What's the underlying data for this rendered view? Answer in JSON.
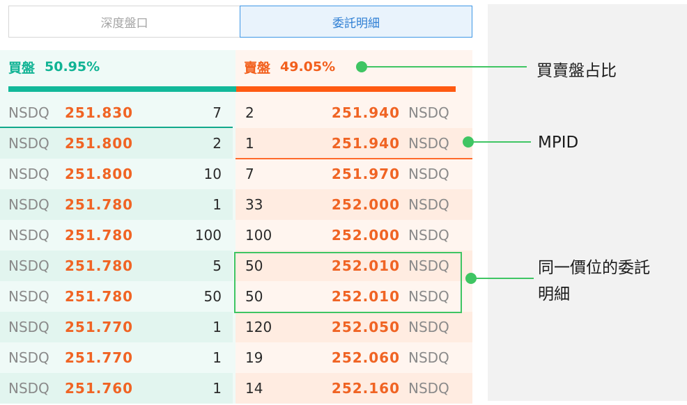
{
  "tabs": [
    {
      "label": "深度盤口"
    },
    {
      "label": "委託明細"
    }
  ],
  "summary": {
    "bid_label": "買盤",
    "bid_ratio": "50.95%",
    "ask_label": "賣盤",
    "ask_ratio": "49.05%"
  },
  "bid_rows": [
    {
      "mpid": "NSDQ",
      "price": "251.830",
      "qty": "7"
    },
    {
      "mpid": "NSDQ",
      "price": "251.800",
      "qty": "2"
    },
    {
      "mpid": "NSDQ",
      "price": "251.800",
      "qty": "10"
    },
    {
      "mpid": "NSDQ",
      "price": "251.780",
      "qty": "1"
    },
    {
      "mpid": "NSDQ",
      "price": "251.780",
      "qty": "100"
    },
    {
      "mpid": "NSDQ",
      "price": "251.780",
      "qty": "5"
    },
    {
      "mpid": "NSDQ",
      "price": "251.780",
      "qty": "50"
    },
    {
      "mpid": "NSDQ",
      "price": "251.770",
      "qty": "1"
    },
    {
      "mpid": "NSDQ",
      "price": "251.770",
      "qty": "1"
    },
    {
      "mpid": "NSDQ",
      "price": "251.760",
      "qty": "1"
    }
  ],
  "ask_rows": [
    {
      "qty": "2",
      "price": "251.940",
      "mpid": "NSDQ"
    },
    {
      "qty": "1",
      "price": "251.940",
      "mpid": "NSDQ"
    },
    {
      "qty": "7",
      "price": "251.970",
      "mpid": "NSDQ"
    },
    {
      "qty": "33",
      "price": "252.000",
      "mpid": "NSDQ"
    },
    {
      "qty": "100",
      "price": "252.000",
      "mpid": "NSDQ"
    },
    {
      "qty": "50",
      "price": "252.010",
      "mpid": "NSDQ"
    },
    {
      "qty": "50",
      "price": "252.010",
      "mpid": "NSDQ"
    },
    {
      "qty": "120",
      "price": "252.050",
      "mpid": "NSDQ"
    },
    {
      "qty": "19",
      "price": "252.060",
      "mpid": "NSDQ"
    },
    {
      "qty": "14",
      "price": "252.160",
      "mpid": "NSDQ"
    }
  ],
  "annotations": {
    "ratio": "買賣盤占比",
    "mpid": "MPID",
    "same_price_line1": "同一價位的委託",
    "same_price_line2": "明細"
  },
  "colors": {
    "bid": "#12b89a",
    "ask": "#ff5a12",
    "price": "#f06424",
    "annotation": "#3fc563",
    "tab_active": "#3e97e6"
  }
}
